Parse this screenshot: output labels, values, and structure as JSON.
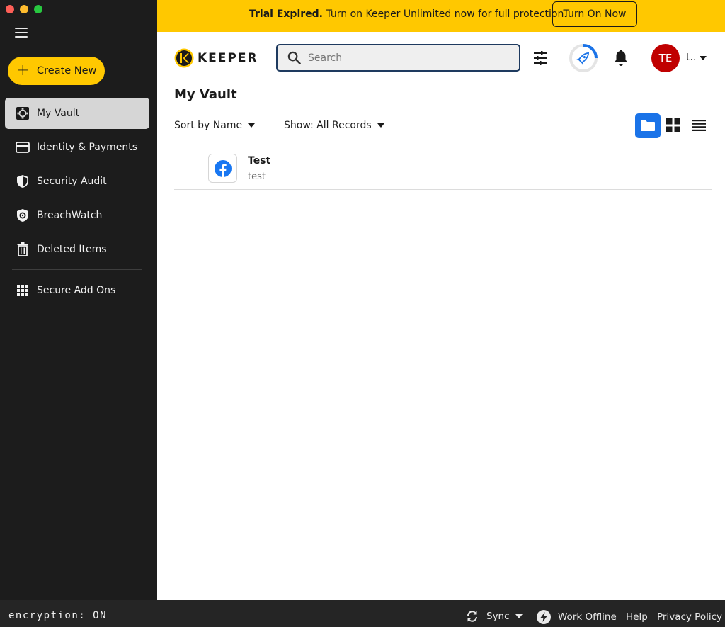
{
  "window": {
    "controls": [
      "close",
      "minimize",
      "maximize"
    ]
  },
  "colors": {
    "brand_yellow": "#ffc800",
    "sidebar_bg": "#1c1c1c",
    "accent_blue": "#1a73e8",
    "avatar_red": "#c00000"
  },
  "banner": {
    "bold_text": "Trial Expired.",
    "text": " Turn on Keeper Unlimited now for full protection.",
    "button_label": "Turn On Now"
  },
  "sidebar": {
    "create_label": "Create New",
    "items": [
      {
        "label": "My Vault",
        "icon": "vault-icon",
        "active": true
      },
      {
        "label": "Identity & Payments",
        "icon": "card-icon",
        "active": false
      },
      {
        "label": "Security Audit",
        "icon": "shield-icon",
        "active": false
      },
      {
        "label": "BreachWatch",
        "icon": "breachwatch-icon",
        "active": false
      },
      {
        "label": "Deleted Items",
        "icon": "trash-icon",
        "active": false
      },
      {
        "label": "Secure Add Ons",
        "icon": "grid-icon",
        "active": false
      }
    ]
  },
  "header": {
    "logo_text": "KEEPER",
    "search_placeholder": "Search",
    "avatar_initials": "TE",
    "user_name": "t.."
  },
  "main": {
    "title": "My Vault",
    "sort_label": "Sort by Name",
    "show_label": "Show: All Records",
    "records": [
      {
        "title": "Test",
        "subtitle": "test",
        "icon": "facebook-icon"
      }
    ]
  },
  "footer": {
    "encryption": "encryption: ON",
    "sync_label": "Sync",
    "offline_label": "Work Offline",
    "help_label": "Help",
    "privacy_label": "Privacy Policy"
  }
}
